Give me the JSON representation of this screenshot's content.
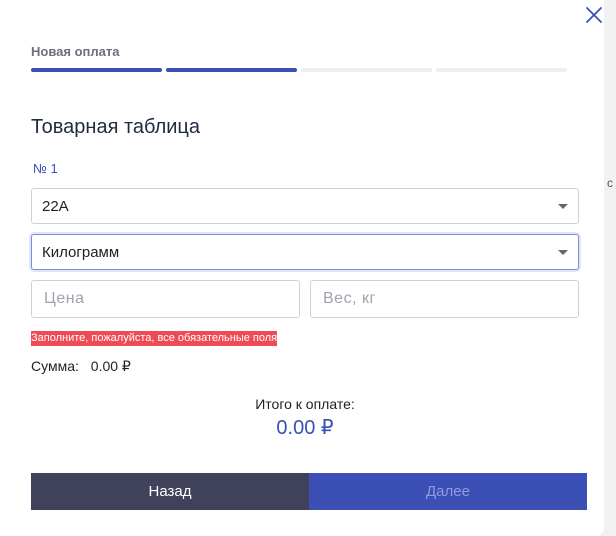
{
  "outside_char": "с",
  "close_icon": "close-icon",
  "header": {
    "step_title": "Новая оплата",
    "progress_steps": [
      true,
      true,
      false,
      false
    ]
  },
  "section_title": "Товарная таблица",
  "item_number": "№ 1",
  "fields": {
    "product": {
      "value": "22A"
    },
    "unit": {
      "value": "Килограмм"
    },
    "price": {
      "placeholder": "Цена",
      "value": ""
    },
    "weight": {
      "placeholder": "Вес, кг",
      "value": ""
    }
  },
  "error_message": "Заполните, пожалуйста, все обязательные поля",
  "sum": {
    "label": "Сумма:",
    "value": "0.00 ₽"
  },
  "total": {
    "label": "Итого к оплате:",
    "value": "0.00 ₽"
  },
  "buttons": {
    "back": "Назад",
    "next": "Далее"
  },
  "colors": {
    "accent": "#3b4fb5",
    "back_button": "#40415a",
    "error": "#ef4b55"
  }
}
